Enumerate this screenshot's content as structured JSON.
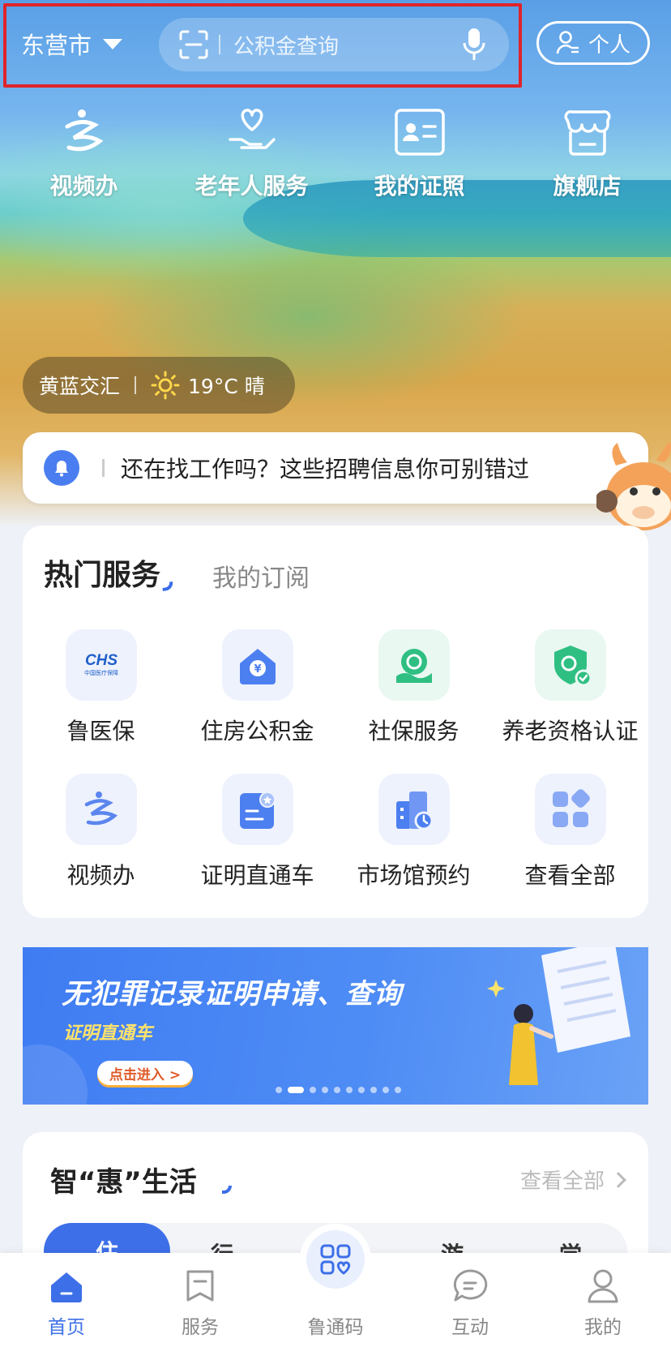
{
  "header": {
    "city": "东营市",
    "search_placeholder": "公积金查询",
    "personal_label": "个人"
  },
  "quick_actions": [
    {
      "label": "视频办",
      "icon": "video-service-icon"
    },
    {
      "label": "老年人服务",
      "icon": "elderly-care-icon"
    },
    {
      "label": "我的证照",
      "icon": "id-card-icon"
    },
    {
      "label": "旗舰店",
      "icon": "store-icon"
    }
  ],
  "weather": {
    "place": "黄蓝交汇",
    "temp": "19°C 晴"
  },
  "notice": {
    "text": "还在找工作吗？这些招聘信息你可别错过"
  },
  "hot_services": {
    "tab_active": "热门服务",
    "tab_inactive": "我的订阅",
    "items": [
      {
        "label": "鲁医保",
        "icon": "chs-medical-insurance-icon",
        "logo_text": "CHS",
        "logo_sub": "中国医疗保障"
      },
      {
        "label": "住房公积金",
        "icon": "housing-fund-icon"
      },
      {
        "label": "社保服务",
        "icon": "social-security-icon"
      },
      {
        "label": "养老资格认证",
        "icon": "pension-certification-icon"
      },
      {
        "label": "视频办",
        "icon": "video-service-icon"
      },
      {
        "label": "证明直通车",
        "icon": "certificate-icon"
      },
      {
        "label": "市场馆预约",
        "icon": "venue-booking-icon"
      },
      {
        "label": "查看全部",
        "icon": "all-apps-icon"
      }
    ]
  },
  "banner": {
    "title": "无犯罪记录证明申请、查询",
    "subtitle": "证明直通车",
    "button": "点击进入 >",
    "dot_count": 10,
    "active_dot": 1
  },
  "smart_life": {
    "title": "智“惠”生活",
    "more": "查看全部",
    "tabs": [
      "住",
      "行",
      "游",
      "学"
    ]
  },
  "bottom_nav": {
    "items": [
      {
        "label": "首页",
        "active": true
      },
      {
        "label": "服务",
        "active": false
      },
      {
        "label": "鲁通码",
        "active": false
      },
      {
        "label": "互动",
        "active": false
      },
      {
        "label": "我的",
        "active": false
      }
    ]
  },
  "colors": {
    "accent": "#3d6fe8",
    "highlight_border": "#e0242b",
    "service_green": "#2fbf83"
  }
}
